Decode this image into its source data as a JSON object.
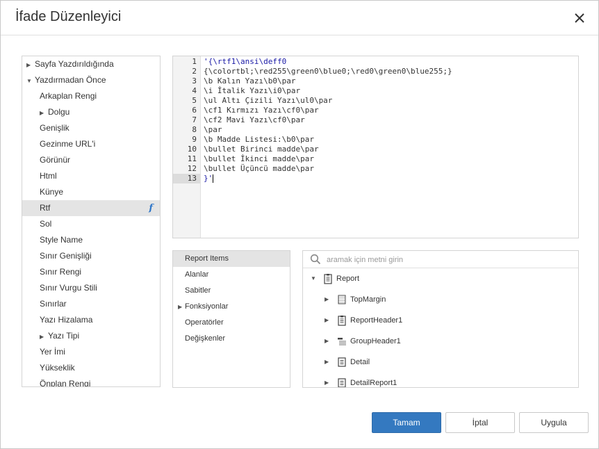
{
  "dialog": {
    "title": "İfade Düzenleyici"
  },
  "properties": [
    {
      "label": "Sayfa Yazdırıldığında",
      "level": 0,
      "caret": "right"
    },
    {
      "label": "Yazdırmadan Önce",
      "level": 0,
      "caret": "down"
    },
    {
      "label": "Arkaplan Rengi",
      "level": 1
    },
    {
      "label": "Dolgu",
      "level": 1,
      "caret": "right"
    },
    {
      "label": "Genişlik",
      "level": 1
    },
    {
      "label": "Gezinme URL'i",
      "level": 1
    },
    {
      "label": "Görünür",
      "level": 1
    },
    {
      "label": "Html",
      "level": 1
    },
    {
      "label": "Künye",
      "level": 1
    },
    {
      "label": "Rtf",
      "level": 1,
      "selected": true,
      "fx": "f"
    },
    {
      "label": "Sol",
      "level": 1
    },
    {
      "label": "Style Name",
      "level": 1
    },
    {
      "label": "Sınır Genişliği",
      "level": 1
    },
    {
      "label": "Sınır Rengi",
      "level": 1
    },
    {
      "label": "Sınır Vurgu Stili",
      "level": 1
    },
    {
      "label": "Sınırlar",
      "level": 1
    },
    {
      "label": "Yazı Hizalama",
      "level": 1
    },
    {
      "label": "Yazı Tipi",
      "level": 1,
      "caret": "right"
    },
    {
      "label": "Yer İmi",
      "level": 1
    },
    {
      "label": "Yükseklik",
      "level": 1
    },
    {
      "label": "Önplan Rengi",
      "level": 1
    }
  ],
  "editor": {
    "active_line": 13,
    "lines": [
      {
        "n": "1",
        "text": "'{\\rtf1\\ansi\\deff0",
        "blue": true
      },
      {
        "n": "2",
        "text": "{\\colortbl;\\red255\\green0\\blue0;\\red0\\green0\\blue255;}",
        "blue": false
      },
      {
        "n": "3",
        "text": "\\b Kalın Yazı\\b0\\par",
        "blue": false
      },
      {
        "n": "4",
        "text": "\\i İtalik Yazı\\i0\\par",
        "blue": false
      },
      {
        "n": "5",
        "text": "\\ul Altı Çizili Yazı\\ul0\\par",
        "blue": false
      },
      {
        "n": "6",
        "text": "\\cf1 Kırmızı Yazı\\cf0\\par",
        "blue": false
      },
      {
        "n": "7",
        "text": "\\cf2 Mavi Yazı\\cf0\\par",
        "blue": false
      },
      {
        "n": "8",
        "text": "\\par",
        "blue": false
      },
      {
        "n": "9",
        "text": "\\b Madde Listesi:\\b0\\par",
        "blue": false
      },
      {
        "n": "10",
        "text": "\\bullet Birinci madde\\par",
        "blue": false
      },
      {
        "n": "11",
        "text": "\\bullet İkinci madde\\par",
        "blue": false
      },
      {
        "n": "12",
        "text": "\\bullet Üçüncü madde\\par",
        "blue": false
      },
      {
        "n": "13",
        "text": "}'",
        "blue": true
      }
    ]
  },
  "categories": [
    {
      "label": "Report Items",
      "selected": true
    },
    {
      "label": "Alanlar"
    },
    {
      "label": "Sabitler"
    },
    {
      "label": "Fonksiyonlar",
      "caret": "right"
    },
    {
      "label": "Operatörler"
    },
    {
      "label": "Değişkenler"
    }
  ],
  "search": {
    "placeholder": "aramak için metni girin"
  },
  "tree": [
    {
      "label": "Report",
      "level": 0,
      "caret": "down",
      "icon": "report-icon"
    },
    {
      "label": "TopMargin",
      "level": 1,
      "caret": "right",
      "icon": "top-margin-icon"
    },
    {
      "label": "ReportHeader1",
      "level": 1,
      "caret": "right",
      "icon": "report-header-icon"
    },
    {
      "label": "GroupHeader1",
      "level": 1,
      "caret": "right",
      "icon": "group-header-icon"
    },
    {
      "label": "Detail",
      "level": 1,
      "caret": "right",
      "icon": "detail-band-icon"
    },
    {
      "label": "DetailReport1",
      "level": 1,
      "caret": "right",
      "icon": "detail-report-icon"
    }
  ],
  "buttons": {
    "ok": "Tamam",
    "cancel": "İptal",
    "apply": "Uygula"
  },
  "colors": {
    "primary": "#3479c0",
    "selected_bg": "#e4e4e4",
    "fx": "#2f76c8",
    "code_blue": "#1a1aa6"
  }
}
